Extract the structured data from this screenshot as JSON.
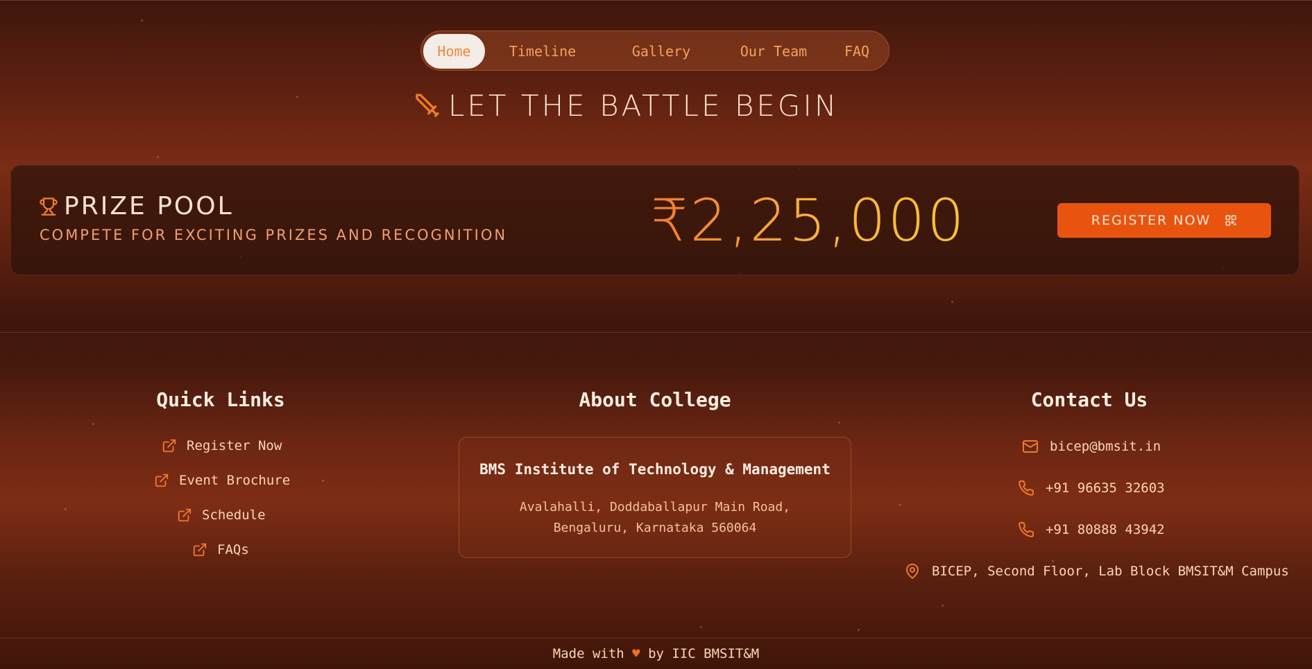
{
  "nav": {
    "items": [
      {
        "label": "Home",
        "active": true
      },
      {
        "label": "Timeline",
        "active": false
      },
      {
        "label": "Gallery",
        "active": false
      },
      {
        "label": "Our Team",
        "active": false
      },
      {
        "label": "FAQ",
        "active": false
      }
    ]
  },
  "hero": {
    "icon": "sword-icon",
    "title": "LET THE BATTLE BEGIN"
  },
  "prize": {
    "icon": "trophy-icon",
    "title": "PRIZE POOL",
    "subtitle": "COMPETE FOR EXCITING PRIZES AND RECOGNITION",
    "amount": "₹2,25,000",
    "register_label": "REGISTER NOW",
    "register_icon": "qr-code-icon"
  },
  "quick_links": {
    "title": "Quick Links",
    "items": [
      "Register Now",
      "Event Brochure",
      "Schedule",
      "FAQs"
    ],
    "icon": "external-link-icon"
  },
  "about": {
    "title": "About College",
    "name": "BMS Institute of Technology & Management",
    "address_line1": "Avalahalli, Doddaballapur Main Road,",
    "address_line2": "Bengaluru, Karnataka 560064"
  },
  "contact": {
    "title": "Contact Us",
    "email": "bicep@bmsit.in",
    "phone1": "+91 96635 32603",
    "phone2": "+91 80888 43942",
    "location": "BICEP, Second Floor, Lab Block BMSIT&M Campus"
  },
  "footer": {
    "made_prefix": "Made with",
    "heart": "♥",
    "made_suffix": "by IIC BMSIT&M"
  },
  "colors": {
    "accent": "#e8540f",
    "gold": "#fbb03b",
    "nav_text": "#f6a15c"
  }
}
